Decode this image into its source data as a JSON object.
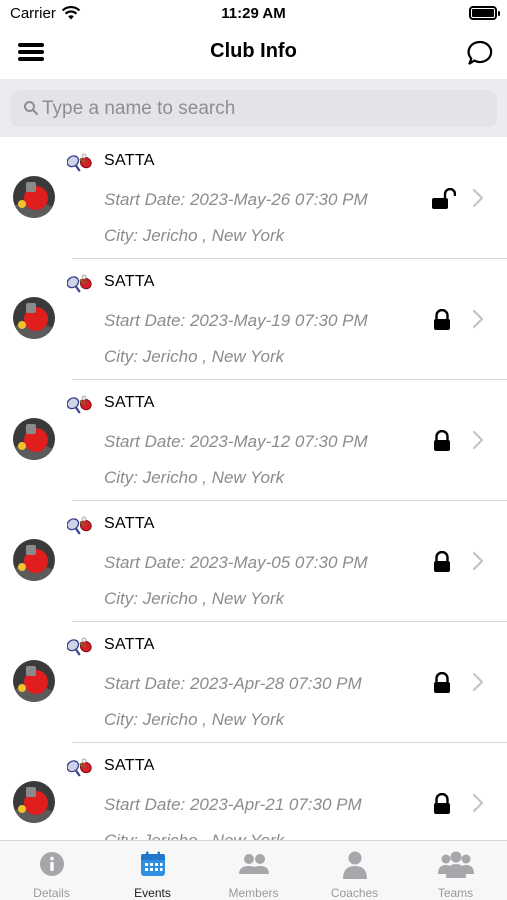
{
  "status_bar": {
    "carrier": "Carrier",
    "time": "11:29 AM"
  },
  "nav": {
    "title": "Club Info",
    "menu_icon": "hamburger-menu-icon",
    "chat_icon": "chat-bubble-icon"
  },
  "search": {
    "placeholder": "Type a name to search",
    "value": ""
  },
  "events": [
    {
      "name": "SATTA",
      "start_date": "Start Date: 2023-May-26 07:30 PM",
      "city": "City: Jericho , New York",
      "lock": "unlocked"
    },
    {
      "name": "SATTA",
      "start_date": "Start Date: 2023-May-19 07:30 PM",
      "city": "City: Jericho , New York",
      "lock": "locked"
    },
    {
      "name": "SATTA",
      "start_date": "Start Date: 2023-May-12 07:30 PM",
      "city": "City: Jericho , New York",
      "lock": "locked"
    },
    {
      "name": "SATTA",
      "start_date": "Start Date: 2023-May-05 07:30 PM",
      "city": "City: Jericho , New York",
      "lock": "locked"
    },
    {
      "name": "SATTA",
      "start_date": "Start Date: 2023-Apr-28 07:30 PM",
      "city": "City: Jericho , New York",
      "lock": "locked"
    },
    {
      "name": "SATTA",
      "start_date": "Start Date: 2023-Apr-21 07:30 PM",
      "city": "City: Jericho , New York",
      "lock": "locked"
    }
  ],
  "tabs": [
    {
      "label": "Details",
      "icon": "info-circle-icon",
      "active": false
    },
    {
      "label": "Events",
      "icon": "calendar-icon",
      "active": true
    },
    {
      "label": "Members",
      "icon": "members-icon",
      "active": false
    },
    {
      "label": "Coaches",
      "icon": "coach-person-icon",
      "active": false
    },
    {
      "label": "Teams",
      "icon": "teams-group-icon",
      "active": false
    }
  ],
  "colors": {
    "accent": "#2f8fe0",
    "inactive_tab": "#9a9a9e",
    "secondary_text": "#8c8c8c",
    "search_bg": "#ececf0"
  }
}
